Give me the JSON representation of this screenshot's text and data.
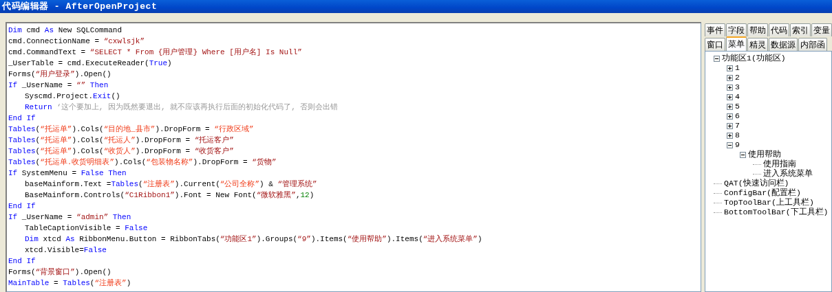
{
  "window": {
    "title": "代码编辑器 - AfterOpenProject"
  },
  "code_lines": [
    {
      "indented": false,
      "tokens": [
        {
          "kind": "kw",
          "t": "Dim"
        },
        {
          "kind": "p",
          "t": " cmd "
        },
        {
          "kind": "kw",
          "t": "As"
        },
        {
          "kind": "p",
          "t": " New SQLCommand"
        }
      ]
    },
    {
      "indented": false,
      "tokens": [
        {
          "kind": "p",
          "t": "cmd.ConnectionName = "
        },
        {
          "kind": "s",
          "t": "“cxwlsjk”"
        }
      ]
    },
    {
      "indented": false,
      "tokens": [
        {
          "kind": "p",
          "t": "cmd.CommandText = "
        },
        {
          "kind": "s",
          "t": "“SELECT * From {用户管理} Where [用户名] Is Null”"
        }
      ]
    },
    {
      "indented": false,
      "tokens": [
        {
          "kind": "p",
          "t": "_UserTable = cmd.ExecuteReader("
        },
        {
          "kind": "kw",
          "t": "True"
        },
        {
          "kind": "p",
          "t": ")"
        }
      ]
    },
    {
      "indented": false,
      "tokens": [
        {
          "kind": "p",
          "t": "Forms("
        },
        {
          "kind": "s",
          "t": "“用户登录”"
        },
        {
          "kind": "p",
          "t": ").Open()"
        }
      ]
    },
    {
      "indented": false,
      "tokens": [
        {
          "kind": "kw",
          "t": "If"
        },
        {
          "kind": "p",
          "t": " _UserName = "
        },
        {
          "kind": "s",
          "t": "“”"
        },
        {
          "kind": "kw",
          "t": " Then"
        }
      ]
    },
    {
      "indented": true,
      "tokens": [
        {
          "kind": "p",
          "t": "Syscmd.Project."
        },
        {
          "kind": "kw",
          "t": "Exit"
        },
        {
          "kind": "p",
          "t": "()"
        }
      ]
    },
    {
      "indented": true,
      "tokens": [
        {
          "kind": "kw",
          "t": "Return"
        },
        {
          "kind": "c",
          "t": " ‘这个要加上, 因为既然要退出, 就不应该再执行后面的初始化代码了, 否则会出错"
        }
      ]
    },
    {
      "indented": false,
      "tokens": [
        {
          "kind": "kw",
          "t": "End If"
        }
      ]
    },
    {
      "indented": false,
      "tokens": [
        {
          "kind": "kw",
          "t": "Tables"
        },
        {
          "kind": "p",
          "t": "("
        },
        {
          "kind": "n",
          "t": "“托运单”"
        },
        {
          "kind": "p",
          "t": ").Cols("
        },
        {
          "kind": "n",
          "t": "“目的地_县市”"
        },
        {
          "kind": "p",
          "t": ").DropForm = "
        },
        {
          "kind": "n",
          "t": "“行政区域”"
        }
      ]
    },
    {
      "indented": false,
      "tokens": [
        {
          "kind": "kw",
          "t": "Tables"
        },
        {
          "kind": "p",
          "t": "("
        },
        {
          "kind": "n",
          "t": "“托运单”"
        },
        {
          "kind": "p",
          "t": ").Cols("
        },
        {
          "kind": "n",
          "t": "“托运人”"
        },
        {
          "kind": "p",
          "t": ").DropForm = "
        },
        {
          "kind": "s",
          "t": "“托运客户”"
        }
      ]
    },
    {
      "indented": false,
      "tokens": [
        {
          "kind": "kw",
          "t": "Tables"
        },
        {
          "kind": "p",
          "t": "("
        },
        {
          "kind": "n",
          "t": "“托运单”"
        },
        {
          "kind": "p",
          "t": ").Cols("
        },
        {
          "kind": "n",
          "t": "“收货人”"
        },
        {
          "kind": "p",
          "t": ").DropForm = "
        },
        {
          "kind": "s",
          "t": "“收货客户”"
        }
      ]
    },
    {
      "indented": false,
      "tokens": [
        {
          "kind": "kw",
          "t": "Tables"
        },
        {
          "kind": "p",
          "t": "("
        },
        {
          "kind": "n",
          "t": "“托运单.收货明细表”"
        },
        {
          "kind": "p",
          "t": ").Cols("
        },
        {
          "kind": "n",
          "t": "“包装物名称”"
        },
        {
          "kind": "p",
          "t": ").DropForm = "
        },
        {
          "kind": "s",
          "t": "“货物”"
        }
      ]
    },
    {
      "indented": false,
      "tokens": [
        {
          "kind": "kw",
          "t": "If"
        },
        {
          "kind": "p",
          "t": " SystemMenu = "
        },
        {
          "kind": "kw",
          "t": "False"
        },
        {
          "kind": "kw",
          "t": " Then"
        }
      ]
    },
    {
      "indented": true,
      "tokens": [
        {
          "kind": "p",
          "t": "baseMainform.Text ="
        },
        {
          "kind": "kw",
          "t": "Tables"
        },
        {
          "kind": "p",
          "t": "("
        },
        {
          "kind": "n",
          "t": "“注册表”"
        },
        {
          "kind": "p",
          "t": ").Current("
        },
        {
          "kind": "n",
          "t": "“公司全称”"
        },
        {
          "kind": "p",
          "t": ") & "
        },
        {
          "kind": "s",
          "t": "“管理系统”"
        }
      ]
    },
    {
      "indented": true,
      "tokens": [
        {
          "kind": "p",
          "t": "BaseMainform.Controls("
        },
        {
          "kind": "s",
          "t": "“C1Ribbon1”"
        },
        {
          "kind": "p",
          "t": ").Font = New Font("
        },
        {
          "kind": "s",
          "t": "“微软雅黑”"
        },
        {
          "kind": "p",
          "t": ","
        },
        {
          "kind": "num",
          "t": "12"
        },
        {
          "kind": "p",
          "t": ")"
        }
      ]
    },
    {
      "indented": false,
      "tokens": [
        {
          "kind": "kw",
          "t": "End If"
        }
      ]
    },
    {
      "indented": false,
      "tokens": [
        {
          "kind": "kw",
          "t": "If"
        },
        {
          "kind": "p",
          "t": " _UserName = "
        },
        {
          "kind": "s",
          "t": "“admin”"
        },
        {
          "kind": "kw",
          "t": " Then"
        }
      ]
    },
    {
      "indented": true,
      "tokens": [
        {
          "kind": "p",
          "t": "TableCaptionVisible = "
        },
        {
          "kind": "kw",
          "t": "False"
        }
      ]
    },
    {
      "indented": true,
      "tokens": [
        {
          "kind": "kw",
          "t": "Dim"
        },
        {
          "kind": "p",
          "t": " xtcd "
        },
        {
          "kind": "kw",
          "t": "As"
        },
        {
          "kind": "p",
          "t": " RibbonMenu.Button = RibbonTabs("
        },
        {
          "kind": "s",
          "t": "“功能区1”"
        },
        {
          "kind": "p",
          "t": ").Groups("
        },
        {
          "kind": "s",
          "t": "“9”"
        },
        {
          "kind": "p",
          "t": ").Items("
        },
        {
          "kind": "s",
          "t": "“使用帮助”"
        },
        {
          "kind": "p",
          "t": ").Items("
        },
        {
          "kind": "s",
          "t": "“进入系统菜单”"
        },
        {
          "kind": "p",
          "t": ")"
        }
      ]
    },
    {
      "indented": true,
      "tokens": [
        {
          "kind": "p",
          "t": "xtcd.Visible="
        },
        {
          "kind": "kw",
          "t": "False"
        }
      ]
    },
    {
      "indented": false,
      "tokens": [
        {
          "kind": "kw",
          "t": "End If"
        }
      ]
    },
    {
      "indented": false,
      "tokens": [
        {
          "kind": "p",
          "t": "Forms("
        },
        {
          "kind": "s",
          "t": "“背景窗口”"
        },
        {
          "kind": "p",
          "t": ").Open()"
        }
      ]
    },
    {
      "indented": false,
      "tokens": [
        {
          "kind": "kw",
          "t": "MainTable"
        },
        {
          "kind": "p",
          "t": " = "
        },
        {
          "kind": "kw",
          "t": "Tables"
        },
        {
          "kind": "p",
          "t": "("
        },
        {
          "kind": "n",
          "t": "“注册表”"
        },
        {
          "kind": "p",
          "t": ")"
        }
      ]
    }
  ],
  "side_tabs": [
    [
      {
        "label": "事件",
        "selected": false
      },
      {
        "label": "字段",
        "selected": false
      },
      {
        "label": "帮助",
        "selected": false
      },
      {
        "label": "代码",
        "selected": false
      },
      {
        "label": "索引",
        "selected": false
      },
      {
        "label": "变量",
        "selected": false
      }
    ],
    [
      {
        "label": "窗口",
        "selected": false
      },
      {
        "label": "菜单",
        "selected": true
      },
      {
        "label": "精灵",
        "selected": false
      },
      {
        "label": "数据源",
        "selected": false
      },
      {
        "label": "内部函",
        "selected": false
      }
    ]
  ],
  "tree": [
    {
      "label": "功能区1(功能区)",
      "expanded": true,
      "children": [
        {
          "label": "1",
          "expanded": false
        },
        {
          "label": "2",
          "expanded": false
        },
        {
          "label": "3",
          "expanded": false
        },
        {
          "label": "4",
          "expanded": false
        },
        {
          "label": "5",
          "expanded": false
        },
        {
          "label": "6",
          "expanded": false
        },
        {
          "label": "7",
          "expanded": false
        },
        {
          "label": "8",
          "expanded": false
        },
        {
          "label": "9",
          "expanded": true,
          "children": [
            {
              "label": "使用帮助",
              "expanded": true,
              "children": [
                {
                  "label": "使用指南"
                },
                {
                  "label": "进入系统菜单"
                }
              ]
            }
          ]
        }
      ]
    },
    {
      "label": "QAT(快速访问栏)"
    },
    {
      "label": "ConfigBar(配置栏)"
    },
    {
      "label": "TopToolBar(上工具栏)"
    },
    {
      "label": "BottomToolBar(下工具栏)"
    }
  ]
}
